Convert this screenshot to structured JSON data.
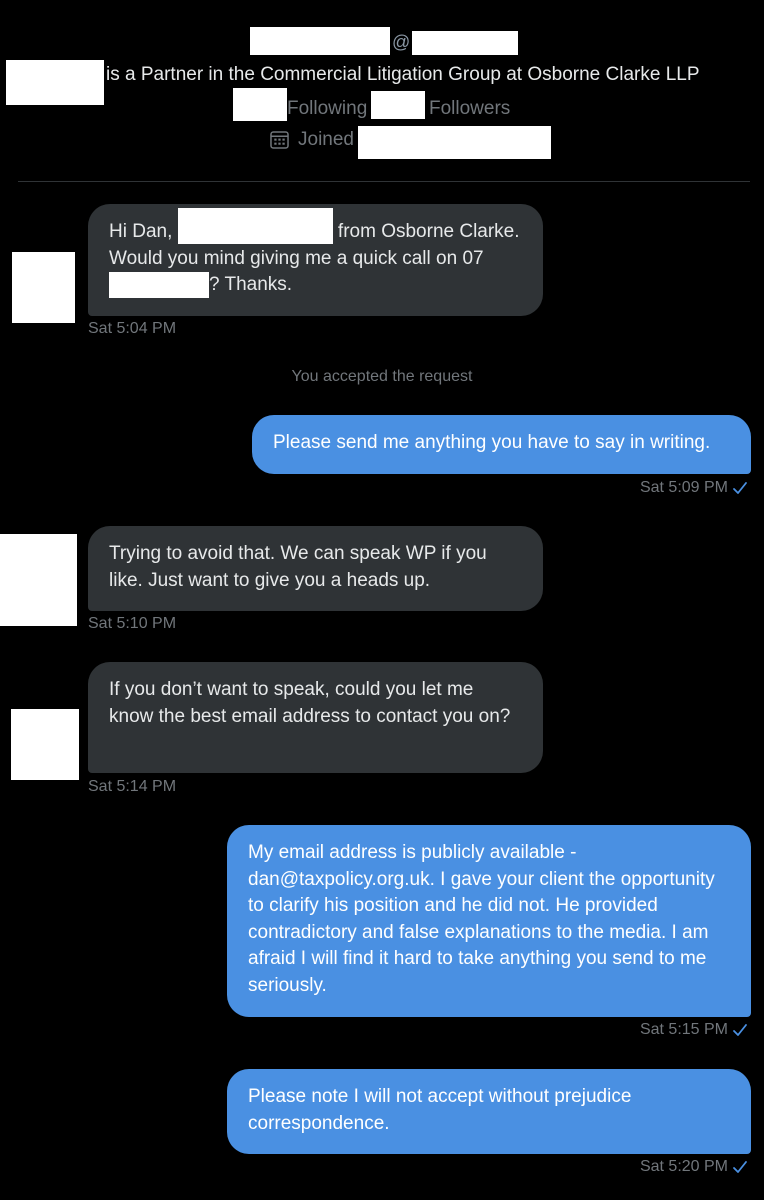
{
  "profile": {
    "at_sign": "@",
    "bio": "is a Partner in the Commercial Litigation Group at Osborne Clarke LLP",
    "following_label": "Following",
    "followers_label": "Followers",
    "joined_label": "Joined"
  },
  "messages": [
    {
      "direction": "incoming",
      "parts": [
        "Hi Dan, ",
        " from Osborne Clarke. Would you mind giving me a quick call on 07",
        "? Thanks."
      ],
      "time": "Sat 5:04 PM"
    },
    {
      "direction": "incoming",
      "text": "Trying to avoid that. We can speak WP if you like. Just want to give you a heads up.",
      "time": "Sat 5:10 PM"
    },
    {
      "direction": "incoming",
      "text": "If you don’t want to speak, could you let me know the best email address to contact you on?",
      "time": "Sat 5:14 PM"
    }
  ],
  "outgoing": [
    {
      "text": "Please send me anything you have to say in writing.",
      "time": "Sat 5:09 PM"
    },
    {
      "text": "My email address is publicly available - dan@taxpolicy.org.uk. I gave your client the opportunity to clarify his position and he did not. He provided contradictory and false explanations to the media. I am afraid I will find it hard to take anything you send to me seriously.",
      "time": "Sat 5:15 PM"
    },
    {
      "text": "Please note I will not accept without prejudice correspondence.",
      "time": "Sat 5:20 PM"
    }
  ],
  "system_message": "You accepted the request",
  "colors": {
    "background": "#000000",
    "incoming_bubble": "#2f3336",
    "outgoing_bubble": "#4a90e2",
    "muted_text": "#71767b",
    "read_check": "#4a90e2"
  },
  "icons": {
    "calendar": "calendar-icon",
    "read_receipt": "checkmark-icon"
  }
}
